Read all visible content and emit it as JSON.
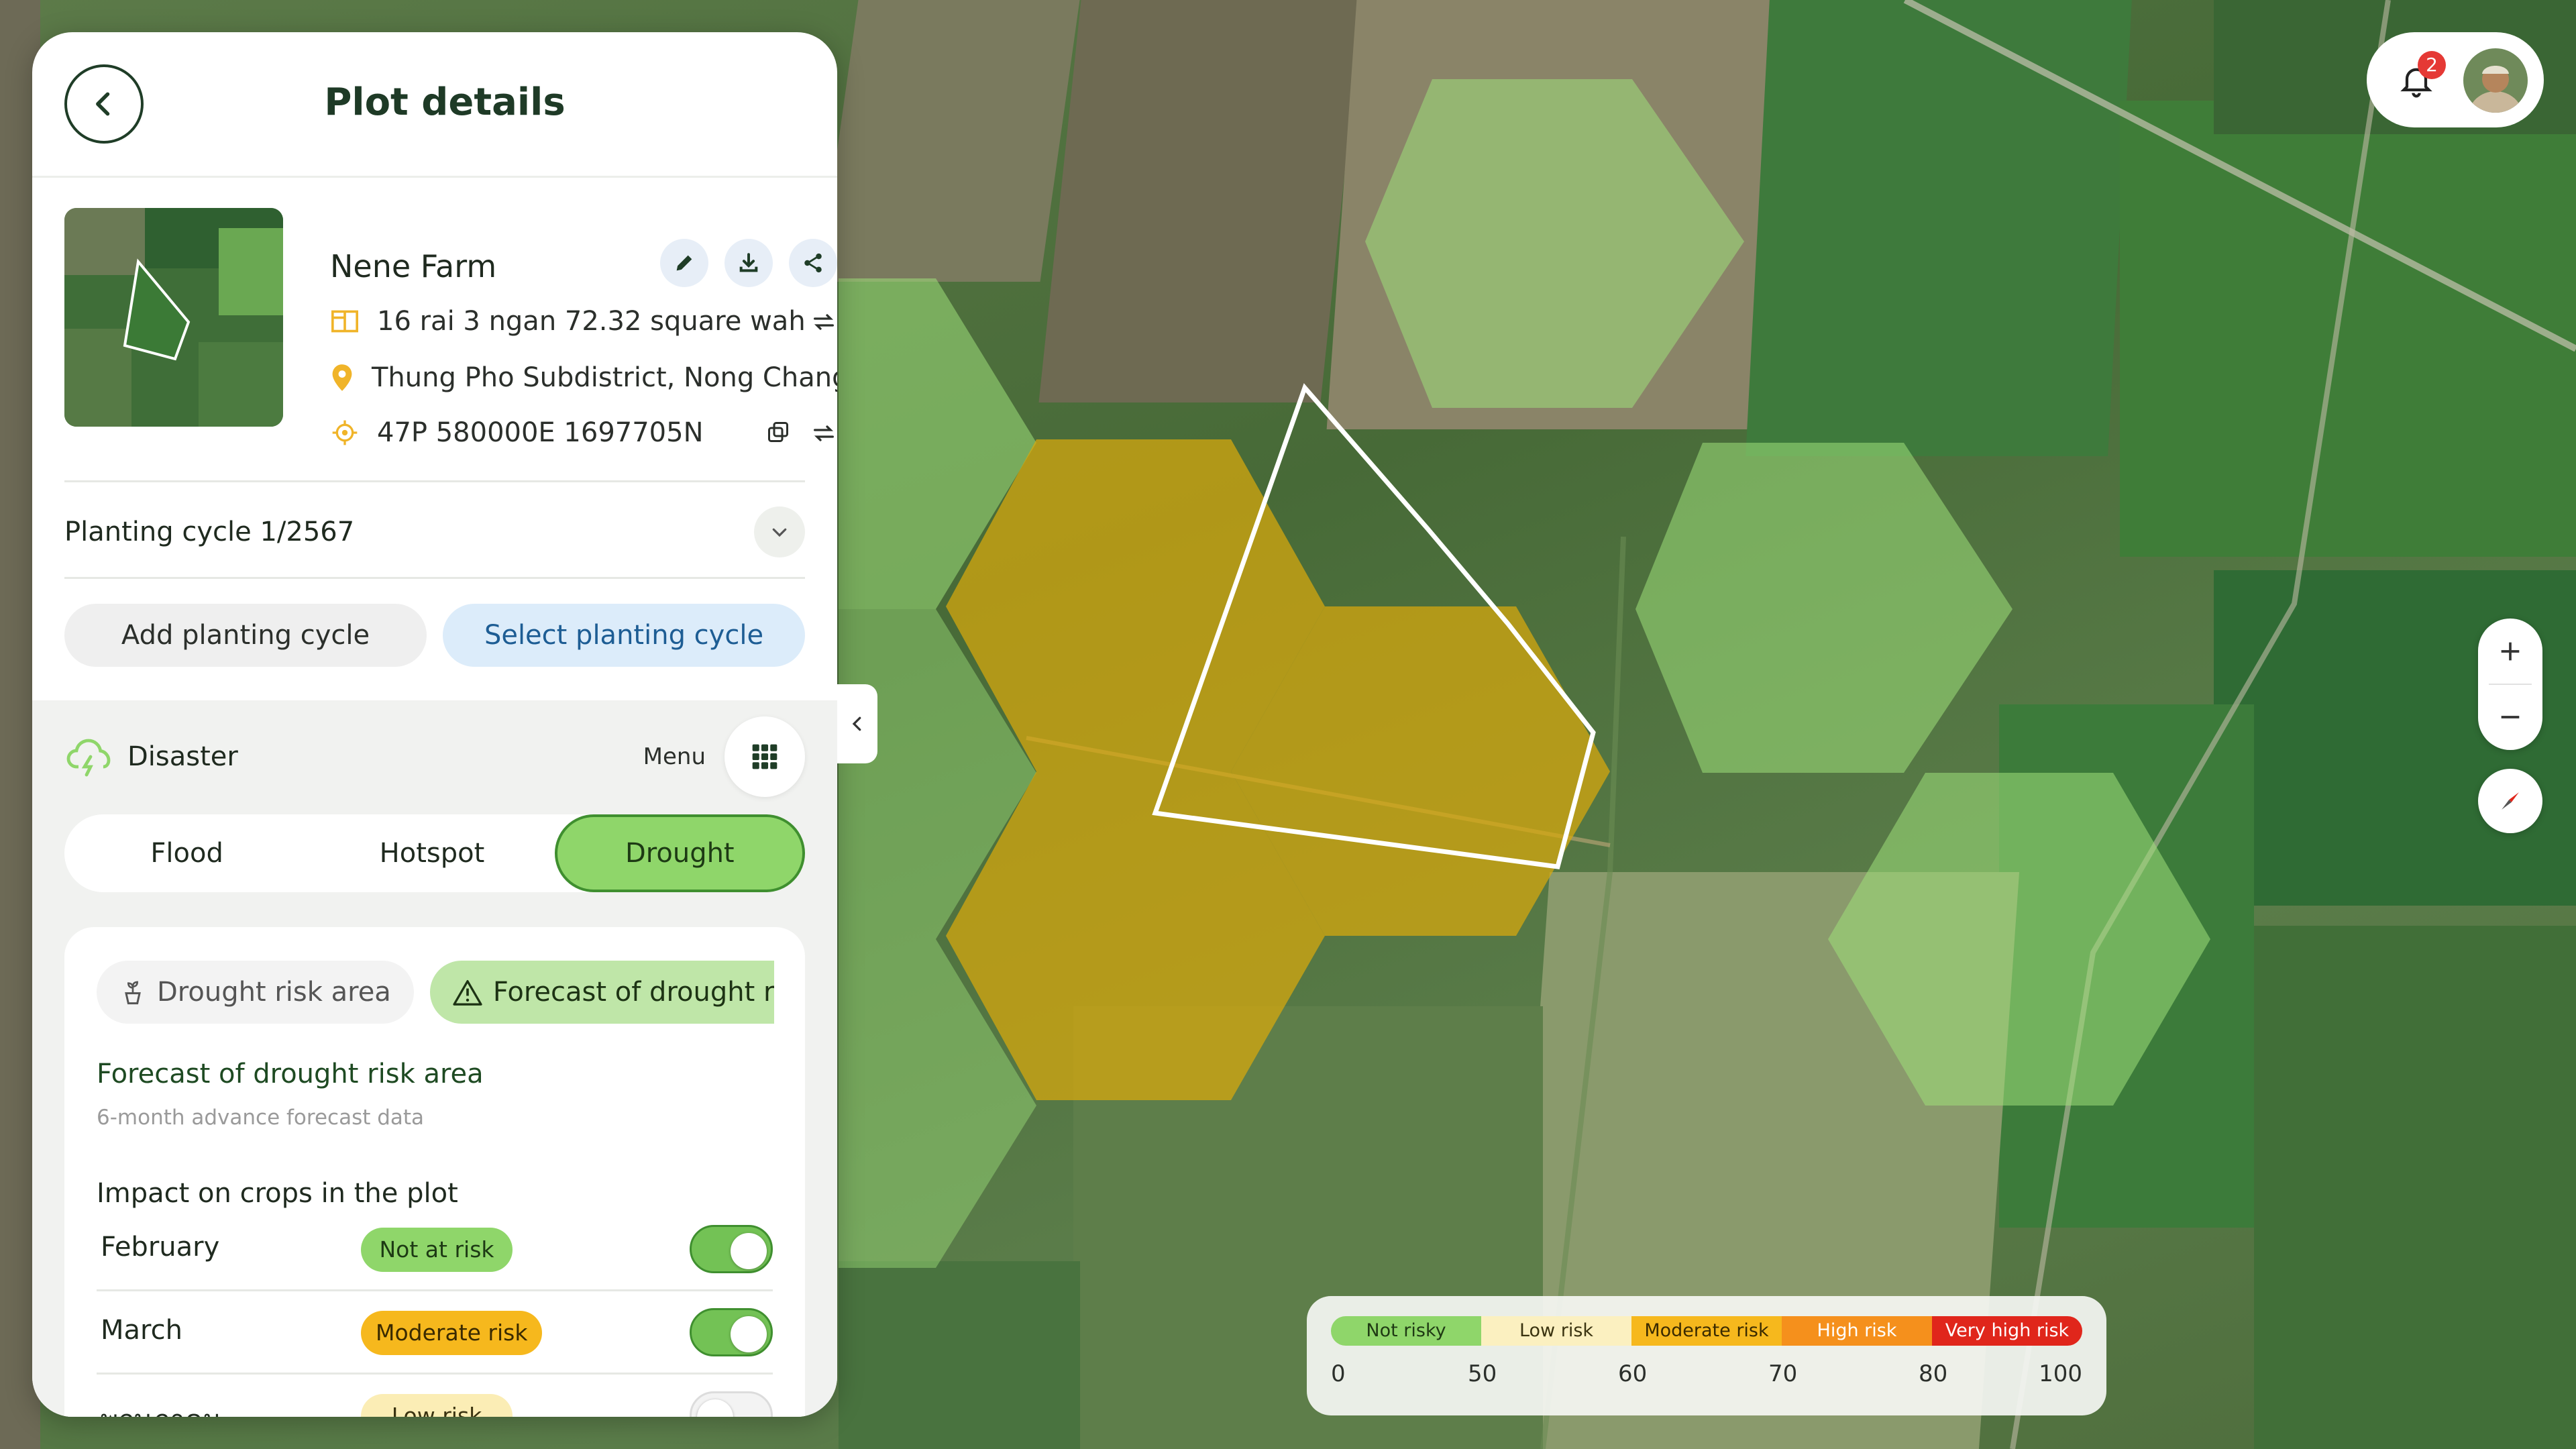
{
  "panel": {
    "title": "Plot details",
    "farm": {
      "name": "Nene Farm",
      "area": "16 rai 3 ngan 72.32 square wah",
      "location": "Thung Pho Subdistrict, Nong Chang District",
      "coordinates": "47P 580000E 1697705N"
    },
    "planting_cycle": "Planting cycle 1/2567",
    "add_cycle_label": "Add planting cycle",
    "select_cycle_label": "Select planting cycle",
    "disaster": {
      "label": "Disaster",
      "menu_label": "Menu",
      "tabs": [
        "Flood",
        "Hotspot",
        "Drought"
      ],
      "active_tab": "Drought"
    },
    "drought": {
      "chips": [
        "Drought risk area",
        "Forecast of drought risk area"
      ],
      "title": "Forecast of drought risk area",
      "subtitle": "6-month advance forecast data",
      "impact_title": "Impact on crops in the plot",
      "months": [
        {
          "name": "February",
          "status": "Not at risk",
          "color": "#8fd66a",
          "text_color": "#1d3a14",
          "enabled": true
        },
        {
          "name": "March",
          "status": "Moderate risk",
          "color": "#f6b81d",
          "text_color": "#3a2a00",
          "enabled": true
        },
        {
          "name": "พฤษภาคม",
          "status": "Low risk",
          "color": "#fbedb5",
          "text_color": "#3a3310",
          "enabled": false
        }
      ]
    }
  },
  "notifications": {
    "count": "2"
  },
  "legend": {
    "categories": [
      {
        "label": "Not risky",
        "color": "#8fd66a",
        "text_color": "#1f3a14"
      },
      {
        "label": "Low risk",
        "color": "#fbf0c0",
        "text_color": "#3a3310"
      },
      {
        "label": "Moderate risk",
        "color": "#f6b81d",
        "text_color": "#3a2a00"
      },
      {
        "label": "High risk",
        "color": "#f5901c",
        "text_color": "#ffffff"
      },
      {
        "label": "Very high risk",
        "color": "#e0261b",
        "text_color": "#ffffff"
      }
    ],
    "ticks": [
      "0",
      "50",
      "60",
      "70",
      "80",
      "100"
    ]
  },
  "colors": {
    "hex_green": "#9ee07a",
    "hex_yellow": "#d9a90c",
    "accent_dark": "#1e3a26"
  }
}
